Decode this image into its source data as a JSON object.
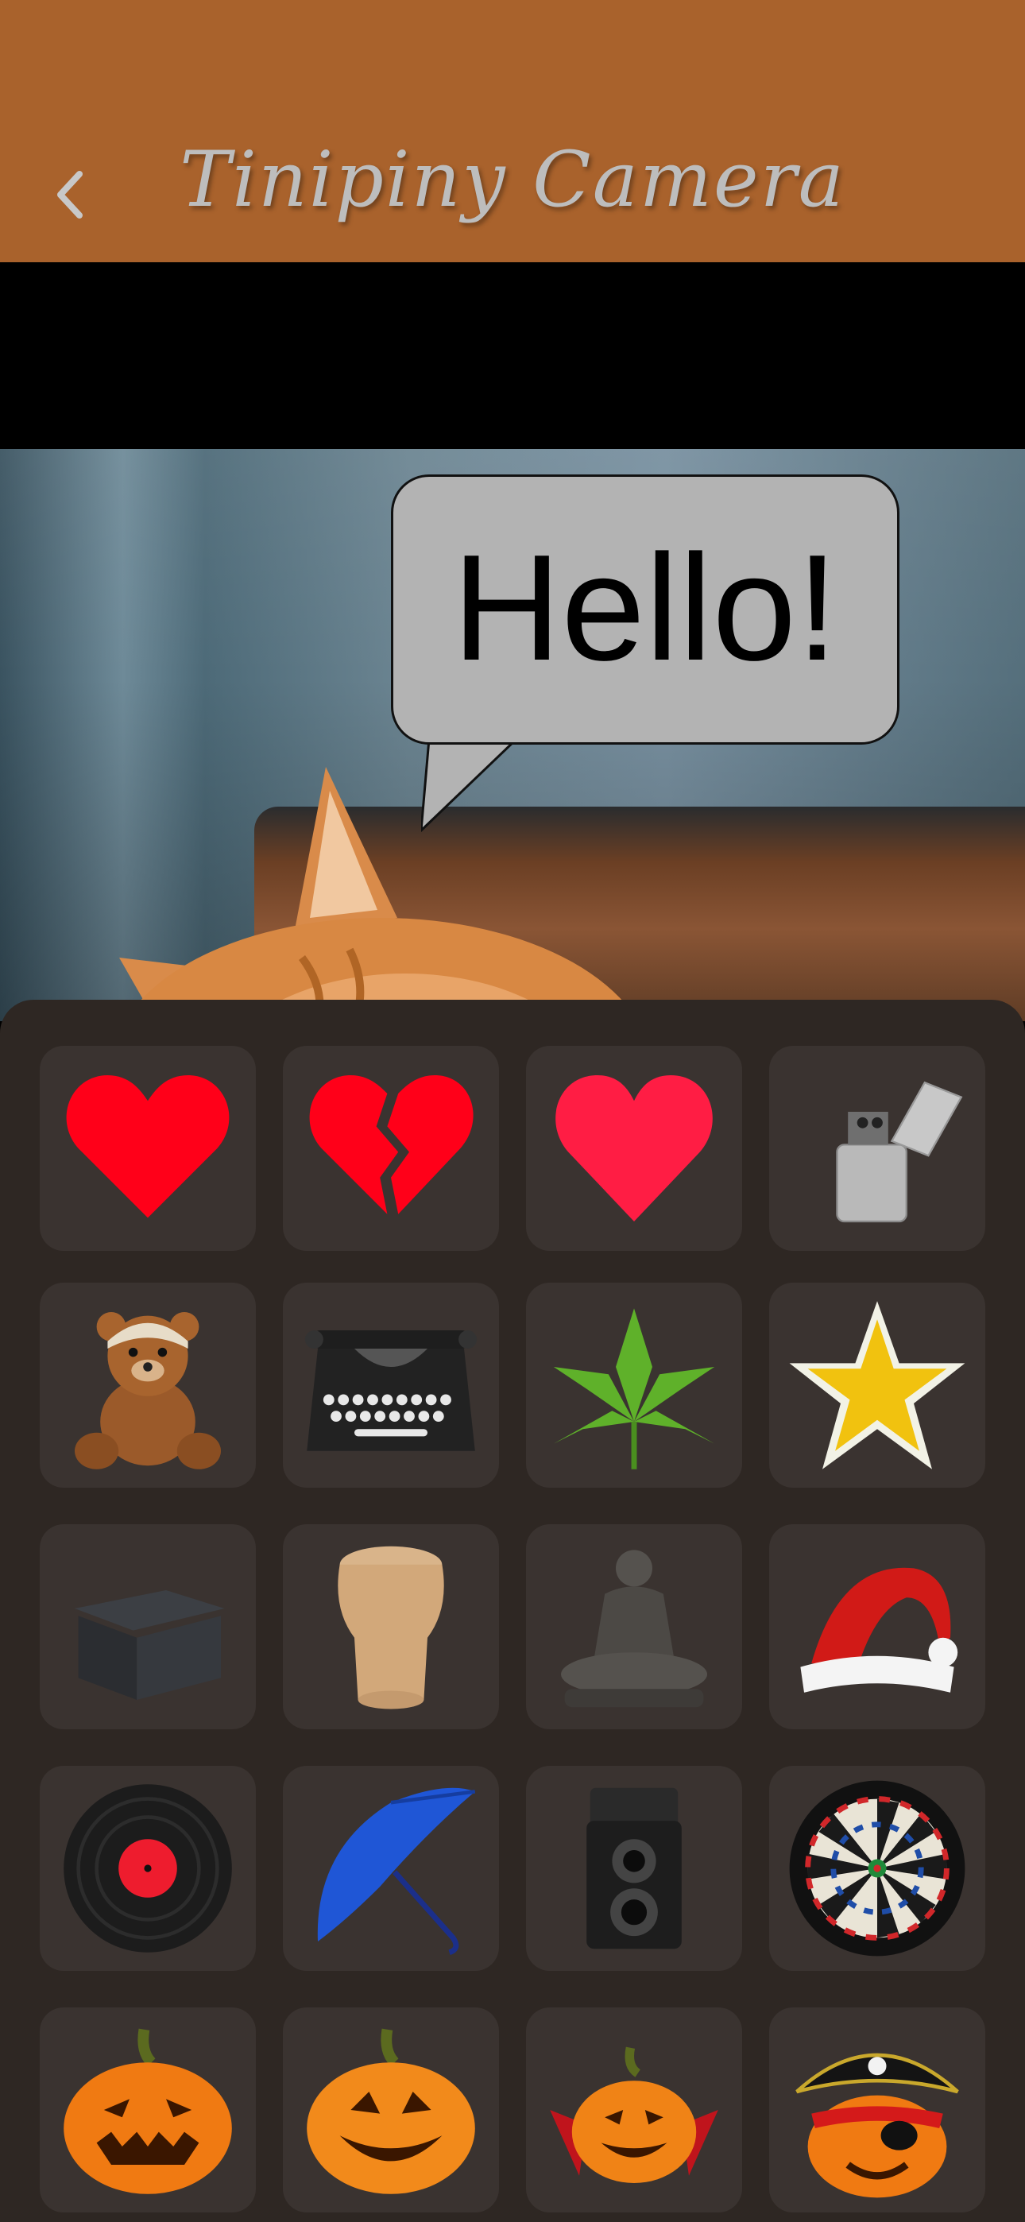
{
  "header": {
    "title": "Tinipiny Camera",
    "back_icon": "chevron-left-icon",
    "background": "#a9622c"
  },
  "canvas": {
    "speech_bubble_text": "Hello!",
    "photo_subject": "cat"
  },
  "stickers": [
    {
      "name": "red-heart"
    },
    {
      "name": "broken-heart"
    },
    {
      "name": "pink-heart"
    },
    {
      "name": "lighter"
    },
    {
      "name": "teddy-bear"
    },
    {
      "name": "typewriter"
    },
    {
      "name": "leaf"
    },
    {
      "name": "star"
    },
    {
      "name": "box"
    },
    {
      "name": "champagne-cork"
    },
    {
      "name": "buddha-statue"
    },
    {
      "name": "santa-hat"
    },
    {
      "name": "vinyl-record"
    },
    {
      "name": "umbrella"
    },
    {
      "name": "twin-lens-camera"
    },
    {
      "name": "dartboard"
    },
    {
      "name": "jack-o-lantern-angry"
    },
    {
      "name": "jack-o-lantern-smiling"
    },
    {
      "name": "jack-o-lantern-vampire"
    },
    {
      "name": "jack-o-lantern-pirate"
    }
  ]
}
